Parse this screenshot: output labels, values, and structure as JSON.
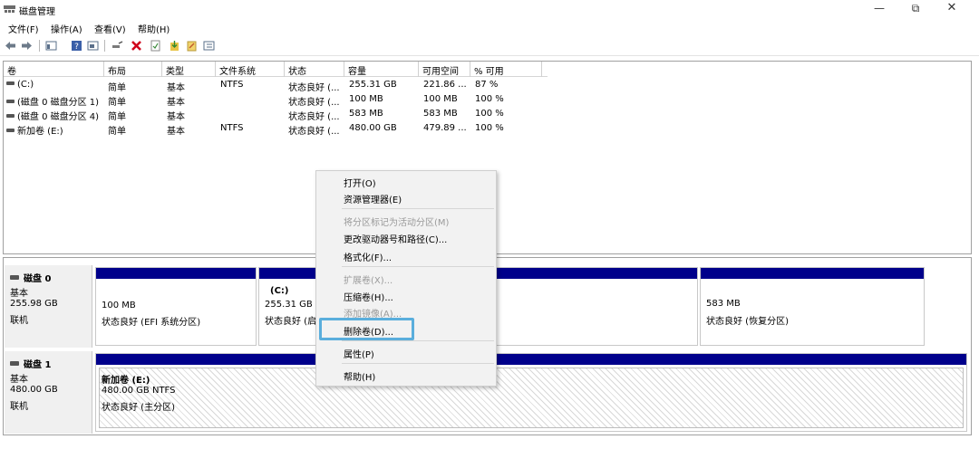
{
  "window": {
    "title": "磁盘管理",
    "controls": {
      "minimize": "—",
      "maximize": "⧉",
      "close": "✕"
    }
  },
  "menu": [
    "文件(F)",
    "操作(A)",
    "查看(V)",
    "帮助(H)"
  ],
  "toolbar_icons": [
    "back-arrow-icon",
    "forward-arrow-icon",
    "console-tree-icon",
    "help-icon",
    "properties-icon",
    "connect-icon",
    "delete-icon",
    "check-icon",
    "import-icon",
    "new-volume-icon",
    "layout-icon"
  ],
  "colors": {
    "partition_bar": "#00008b",
    "highlight": "#5aaedc",
    "delete_icon": "#d0021b"
  },
  "volume_list": {
    "columns": [
      "卷",
      "布局",
      "类型",
      "文件系统",
      "状态",
      "容量",
      "可用空间",
      "% 可用"
    ],
    "rows": [
      [
        "(C:)",
        "简单",
        "基本",
        "NTFS",
        "状态良好 (...",
        "255.31 GB",
        "221.86 ...",
        "87 %"
      ],
      [
        "(磁盘 0 磁盘分区 1)",
        "简单",
        "基本",
        "",
        "状态良好 (...",
        "100 MB",
        "100 MB",
        "100 %"
      ],
      [
        "(磁盘 0 磁盘分区 4)",
        "简单",
        "基本",
        "",
        "状态良好 (...",
        "583 MB",
        "583 MB",
        "100 %"
      ],
      [
        "新加卷 (E:)",
        "简单",
        "基本",
        "NTFS",
        "状态良好 (...",
        "480.00 GB",
        "479.89 ...",
        "100 %"
      ]
    ]
  },
  "disks": [
    {
      "name": "磁盘 0",
      "type": "基本",
      "size": "255.98 GB",
      "status": "联机",
      "partitions": [
        {
          "title": "",
          "size": "100 MB",
          "status": "状态良好 (EFI 系统分区)"
        },
        {
          "title": "(C:)",
          "size": "255.31 GB N",
          "status": "状态良好 (启"
        },
        {
          "title": "",
          "size": "583 MB",
          "status": "状态良好 (恢复分区)"
        }
      ]
    },
    {
      "name": "磁盘 1",
      "type": "基本",
      "size": "480.00 GB",
      "status": "联机",
      "partitions": [
        {
          "title": "新加卷  (E:)",
          "size": "480.00 GB NTFS",
          "status": "状态良好 (主分区)"
        }
      ]
    }
  ],
  "context_menu": {
    "open": "打开(O)",
    "explorer": "资源管理器(E)",
    "mark_active": "将分区标记为活动分区(M)",
    "change_letter": "更改驱动器号和路径(C)...",
    "format": "格式化(F)...",
    "extend": "扩展卷(X)...",
    "shrink": "压缩卷(H)...",
    "add_mirror": "添加镜像(A)...",
    "delete": "删除卷(D)...",
    "properties": "属性(P)",
    "help": "帮助(H)"
  }
}
